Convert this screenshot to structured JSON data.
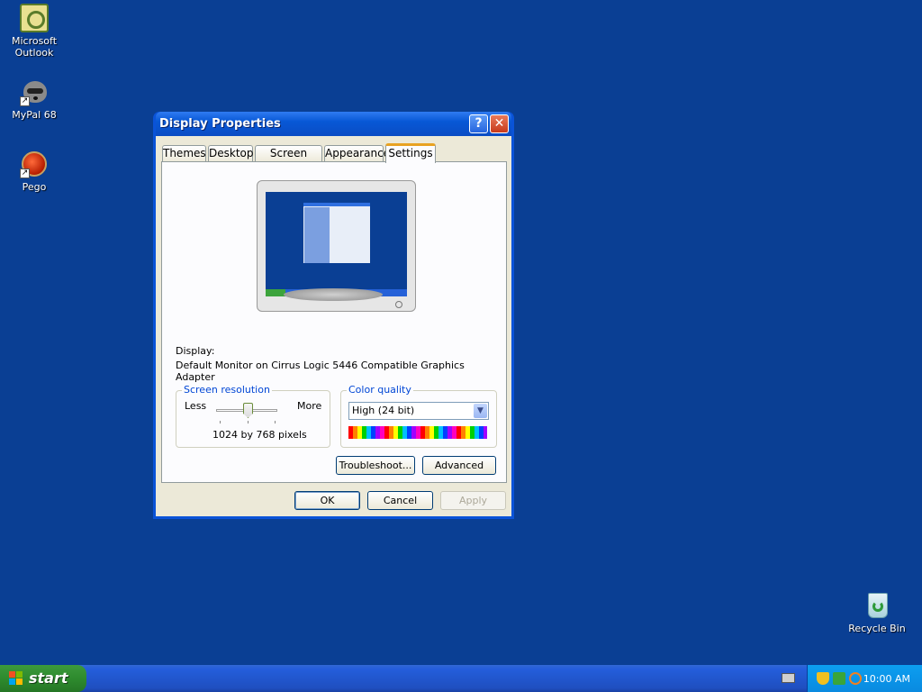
{
  "desktop": {
    "icons": [
      {
        "label": "Microsoft Outlook"
      },
      {
        "label": "MyPal 68"
      },
      {
        "label": "Pego"
      },
      {
        "label": "Recycle Bin"
      }
    ]
  },
  "window": {
    "title": "Display Properties",
    "help_glyph": "?",
    "close_glyph": "✕",
    "tabs": [
      {
        "label": "Themes"
      },
      {
        "label": "Desktop"
      },
      {
        "label": "Screen Saver"
      },
      {
        "label": "Appearance"
      },
      {
        "label": "Settings",
        "active": true
      }
    ],
    "display_label": "Display:",
    "display_value": "Default Monitor on Cirrus Logic 5446 Compatible Graphics Adapter",
    "screen_resolution": {
      "legend": "Screen resolution",
      "less": "Less",
      "more": "More",
      "value_text": "1024 by 768 pixels"
    },
    "color_quality": {
      "legend": "Color quality",
      "selected": "High (24 bit)"
    },
    "buttons": {
      "troubleshoot": "Troubleshoot...",
      "advanced": "Advanced",
      "ok": "OK",
      "cancel": "Cancel",
      "apply": "Apply"
    }
  },
  "taskbar": {
    "start_label": "start",
    "clock": "10:00 AM"
  },
  "colors": {
    "desktop": "#0a3f94",
    "title_bar": "#0858d6",
    "start_button": "#2e8b2e",
    "tray": "#0c9ef0"
  }
}
